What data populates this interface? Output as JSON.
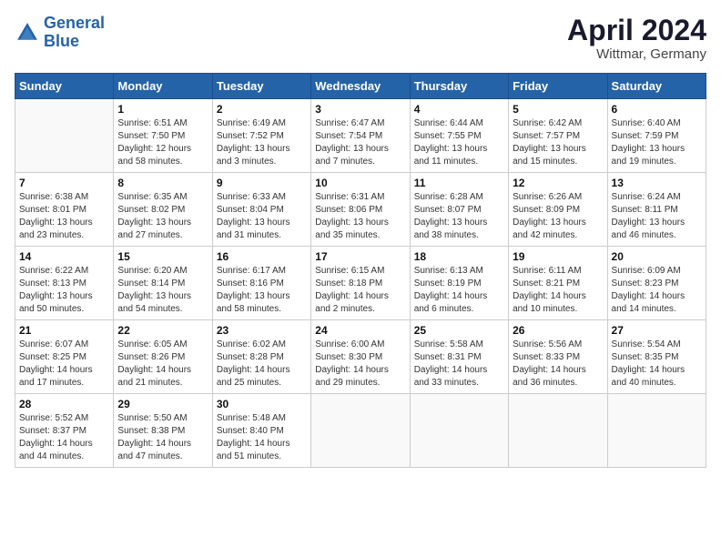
{
  "header": {
    "logo_line1": "General",
    "logo_line2": "Blue",
    "month_title": "April 2024",
    "subtitle": "Wittmar, Germany"
  },
  "days_of_week": [
    "Sunday",
    "Monday",
    "Tuesday",
    "Wednesday",
    "Thursday",
    "Friday",
    "Saturday"
  ],
  "weeks": [
    [
      {
        "day": "",
        "info": ""
      },
      {
        "day": "1",
        "info": "Sunrise: 6:51 AM\nSunset: 7:50 PM\nDaylight: 12 hours\nand 58 minutes."
      },
      {
        "day": "2",
        "info": "Sunrise: 6:49 AM\nSunset: 7:52 PM\nDaylight: 13 hours\nand 3 minutes."
      },
      {
        "day": "3",
        "info": "Sunrise: 6:47 AM\nSunset: 7:54 PM\nDaylight: 13 hours\nand 7 minutes."
      },
      {
        "day": "4",
        "info": "Sunrise: 6:44 AM\nSunset: 7:55 PM\nDaylight: 13 hours\nand 11 minutes."
      },
      {
        "day": "5",
        "info": "Sunrise: 6:42 AM\nSunset: 7:57 PM\nDaylight: 13 hours\nand 15 minutes."
      },
      {
        "day": "6",
        "info": "Sunrise: 6:40 AM\nSunset: 7:59 PM\nDaylight: 13 hours\nand 19 minutes."
      }
    ],
    [
      {
        "day": "7",
        "info": "Sunrise: 6:38 AM\nSunset: 8:01 PM\nDaylight: 13 hours\nand 23 minutes."
      },
      {
        "day": "8",
        "info": "Sunrise: 6:35 AM\nSunset: 8:02 PM\nDaylight: 13 hours\nand 27 minutes."
      },
      {
        "day": "9",
        "info": "Sunrise: 6:33 AM\nSunset: 8:04 PM\nDaylight: 13 hours\nand 31 minutes."
      },
      {
        "day": "10",
        "info": "Sunrise: 6:31 AM\nSunset: 8:06 PM\nDaylight: 13 hours\nand 35 minutes."
      },
      {
        "day": "11",
        "info": "Sunrise: 6:28 AM\nSunset: 8:07 PM\nDaylight: 13 hours\nand 38 minutes."
      },
      {
        "day": "12",
        "info": "Sunrise: 6:26 AM\nSunset: 8:09 PM\nDaylight: 13 hours\nand 42 minutes."
      },
      {
        "day": "13",
        "info": "Sunrise: 6:24 AM\nSunset: 8:11 PM\nDaylight: 13 hours\nand 46 minutes."
      }
    ],
    [
      {
        "day": "14",
        "info": "Sunrise: 6:22 AM\nSunset: 8:13 PM\nDaylight: 13 hours\nand 50 minutes."
      },
      {
        "day": "15",
        "info": "Sunrise: 6:20 AM\nSunset: 8:14 PM\nDaylight: 13 hours\nand 54 minutes."
      },
      {
        "day": "16",
        "info": "Sunrise: 6:17 AM\nSunset: 8:16 PM\nDaylight: 13 hours\nand 58 minutes."
      },
      {
        "day": "17",
        "info": "Sunrise: 6:15 AM\nSunset: 8:18 PM\nDaylight: 14 hours\nand 2 minutes."
      },
      {
        "day": "18",
        "info": "Sunrise: 6:13 AM\nSunset: 8:19 PM\nDaylight: 14 hours\nand 6 minutes."
      },
      {
        "day": "19",
        "info": "Sunrise: 6:11 AM\nSunset: 8:21 PM\nDaylight: 14 hours\nand 10 minutes."
      },
      {
        "day": "20",
        "info": "Sunrise: 6:09 AM\nSunset: 8:23 PM\nDaylight: 14 hours\nand 14 minutes."
      }
    ],
    [
      {
        "day": "21",
        "info": "Sunrise: 6:07 AM\nSunset: 8:25 PM\nDaylight: 14 hours\nand 17 minutes."
      },
      {
        "day": "22",
        "info": "Sunrise: 6:05 AM\nSunset: 8:26 PM\nDaylight: 14 hours\nand 21 minutes."
      },
      {
        "day": "23",
        "info": "Sunrise: 6:02 AM\nSunset: 8:28 PM\nDaylight: 14 hours\nand 25 minutes."
      },
      {
        "day": "24",
        "info": "Sunrise: 6:00 AM\nSunset: 8:30 PM\nDaylight: 14 hours\nand 29 minutes."
      },
      {
        "day": "25",
        "info": "Sunrise: 5:58 AM\nSunset: 8:31 PM\nDaylight: 14 hours\nand 33 minutes."
      },
      {
        "day": "26",
        "info": "Sunrise: 5:56 AM\nSunset: 8:33 PM\nDaylight: 14 hours\nand 36 minutes."
      },
      {
        "day": "27",
        "info": "Sunrise: 5:54 AM\nSunset: 8:35 PM\nDaylight: 14 hours\nand 40 minutes."
      }
    ],
    [
      {
        "day": "28",
        "info": "Sunrise: 5:52 AM\nSunset: 8:37 PM\nDaylight: 14 hours\nand 44 minutes."
      },
      {
        "day": "29",
        "info": "Sunrise: 5:50 AM\nSunset: 8:38 PM\nDaylight: 14 hours\nand 47 minutes."
      },
      {
        "day": "30",
        "info": "Sunrise: 5:48 AM\nSunset: 8:40 PM\nDaylight: 14 hours\nand 51 minutes."
      },
      {
        "day": "",
        "info": ""
      },
      {
        "day": "",
        "info": ""
      },
      {
        "day": "",
        "info": ""
      },
      {
        "day": "",
        "info": ""
      }
    ]
  ]
}
